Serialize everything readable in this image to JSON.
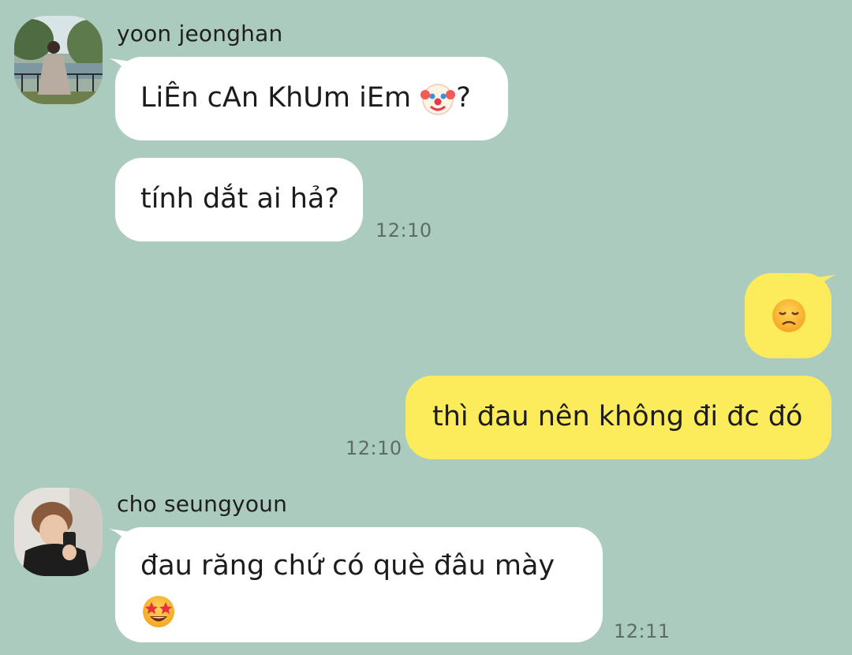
{
  "messages": [
    {
      "sender": "yoon jeonghan",
      "avatar": "avatar-yoon-jeonghan",
      "bubbles": [
        {
          "text": "LiÊn cAn KhUm iEm",
          "suffix": "?",
          "emoji": "clown-face-emoji"
        },
        {
          "text": "tính dắt ai hả?"
        }
      ],
      "time": "12:10"
    },
    {
      "sender": "me",
      "bubbles": [
        {
          "emoji": "disappointed-face-emoji"
        },
        {
          "text": "thì đau nên không đi đc đó"
        }
      ],
      "time": "12:10"
    },
    {
      "sender": "cho seungyoun",
      "avatar": "avatar-cho-seungyoun",
      "bubbles": [
        {
          "text": "đau răng chứ có què đâu mày",
          "emoji": "star-struck-emoji"
        }
      ],
      "time": "12:11"
    }
  ],
  "colors": {
    "background": "#abcbbf",
    "incoming_bubble": "#ffffff",
    "outgoing_bubble": "#fcec5c",
    "timestamp": "#5d6c67"
  }
}
